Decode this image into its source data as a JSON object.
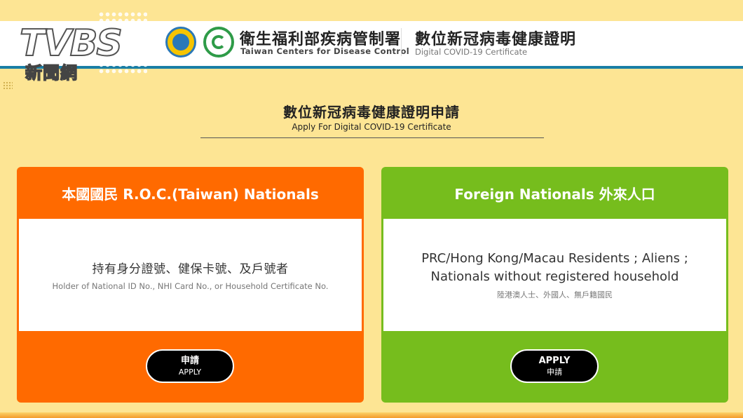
{
  "overlay": {
    "broadcaster_logo_text": "TVBS",
    "broadcaster_logo_subtext": "新聞網"
  },
  "header": {
    "org_name_zh": "衛生福利部疾病管制署",
    "org_name_en": "Taiwan Centers for Disease Control",
    "site_title_zh": "數位新冠病毒健康證明",
    "site_title_en": "Digital COVID-19 Certificate"
  },
  "main": {
    "title_zh": "數位新冠病毒健康證明申請",
    "title_en": "Apply For Digital COVID-19 Certificate"
  },
  "cards": [
    {
      "header": "本國國民 R.O.C.(Taiwan) Nationals",
      "main_text": "持有身分證號、健保卡號、及戶號者",
      "sub_text": "Holder of National ID No., NHI Card No., or Household Certificate No.",
      "button_line1": "申請",
      "button_line2": "APPLY",
      "color": "#ff6a00"
    },
    {
      "header": "Foreign Nationals 外來人口",
      "main_line1": "PRC/Hong Kong/Macau Residents ; Aliens ;",
      "main_line2": "Nationals without registered household",
      "sub_text": "陸港澳人士、外國人、無戶籍國民",
      "button_line1": "APPLY",
      "button_line2": "申請",
      "color": "#76bd1d"
    }
  ],
  "colors": {
    "background": "#fde594",
    "header_border": "#1a7fa6",
    "button": "#000000"
  },
  "icons": {
    "logo_1": "mohw-emblem-icon",
    "logo_2": "taiwan-cdc-logo-icon"
  }
}
